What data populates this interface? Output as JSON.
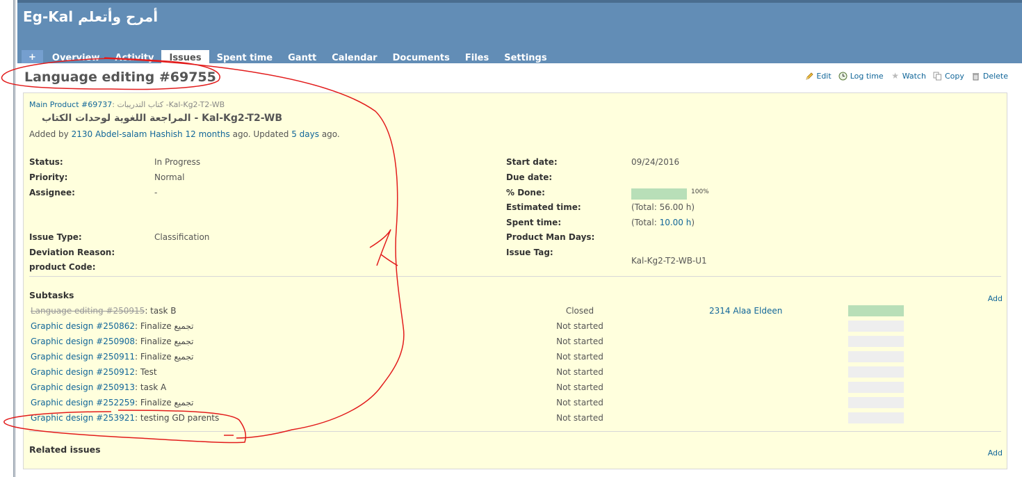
{
  "project": {
    "title": "Eg-Kal أمرح وأتعلم"
  },
  "menu": {
    "plus": "+",
    "tabs": [
      "Overview",
      "Activity",
      "Issues",
      "Spent time",
      "Gantt",
      "Calendar",
      "Documents",
      "Files",
      "Settings"
    ],
    "selected": "Issues"
  },
  "issue": {
    "title": "Language editing #69755",
    "parent_link": "Main Product #69737",
    "parent_suffix": ": كتاب التدريبات -Kal-Kg2-T2-WB",
    "subject": "المراجعة اللغوية لوحدات الكتاب - Kal-Kg2-T2-WB",
    "author_prefix": "Added by ",
    "author": "2130 Abdel-salam Hashish",
    "author_space": " ",
    "added_ago": "12 months",
    "updated_mid": " ago. Updated ",
    "updated_ago": "5 days",
    "updated_suffix": " ago."
  },
  "actions": {
    "edit": "Edit",
    "log_time": "Log time",
    "watch": "Watch",
    "copy": "Copy",
    "delete": "Delete"
  },
  "attributes": {
    "status_label": "Status:",
    "status": "In Progress",
    "priority_label": "Priority:",
    "priority": "Normal",
    "assignee_label": "Assignee:",
    "assignee": "-",
    "issue_type_label": "Issue Type:",
    "issue_type": "Classification",
    "deviation_label": "Deviation Reason:",
    "product_code_label": "product Code:",
    "start_date_label": "Start date:",
    "start_date": "09/24/2016",
    "due_date_label": "Due date:",
    "done_label": "% Done:",
    "done": "100%",
    "done_fraction": 1.0,
    "estimated_label": "Estimated time:",
    "estimated": "(Total: 56.00 h)",
    "spent_label": "Spent time:",
    "spent_prefix": "(Total: ",
    "spent_value": "10.00 h",
    "spent_suffix": ")",
    "man_days_label": "Product Man Days:",
    "issue_tag_label": "Issue Tag:",
    "issue_tag": "Kal-Kg2-T2-WB-U1"
  },
  "subtasks": {
    "title": "Subtasks",
    "add": "Add",
    "rows": [
      {
        "link": "Language editing #250915",
        "text": ": task B",
        "status": "Closed",
        "assignee": "2314 Alaa Eldeen",
        "done_fraction": 1.0,
        "closed": true
      },
      {
        "link": "Graphic design #250862",
        "text": ": Finalize تجميع",
        "status": "Not started",
        "assignee": "",
        "done_fraction": 0
      },
      {
        "link": "Graphic design #250908",
        "text": ": Finalize تجميع",
        "status": "Not started",
        "assignee": "",
        "done_fraction": 0
      },
      {
        "link": "Graphic design #250911",
        "text": ": Finalize تجميع",
        "status": "Not started",
        "assignee": "",
        "done_fraction": 0
      },
      {
        "link": "Graphic design #250912",
        "text": ": Test",
        "status": "Not started",
        "assignee": "",
        "done_fraction": 0
      },
      {
        "link": "Graphic design #250913",
        "text": ": task A",
        "status": "Not started",
        "assignee": "",
        "done_fraction": 0
      },
      {
        "link": "Graphic design #252259",
        "text": ": Finalize تجميع",
        "status": "Not started",
        "assignee": "",
        "done_fraction": 0
      },
      {
        "link": "Graphic design #253921",
        "text": ": testing GD parents",
        "status": "Not started",
        "assignee": "",
        "done_fraction": 0
      }
    ]
  },
  "related": {
    "title": "Related issues",
    "add": "Add"
  },
  "colors": {
    "header": "#628db6",
    "box_bg": "#ffffdd",
    "link": "#116699",
    "annotation": "#e21b1b",
    "progress_done": "#b8dfb8",
    "progress_todo": "#eeeeee"
  }
}
